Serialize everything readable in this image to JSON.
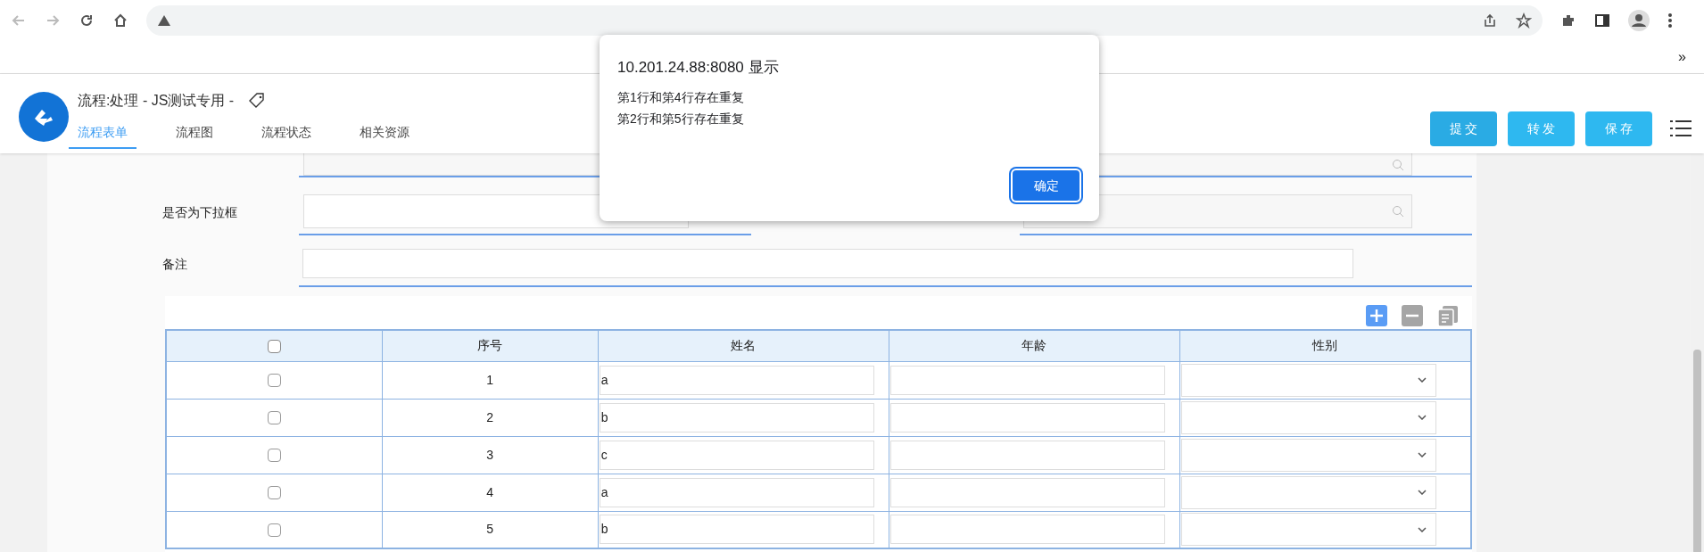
{
  "browser": {
    "bookmarks_overflow": "»"
  },
  "app": {
    "title": "流程:处理 - JS测试专用 -",
    "tabs": [
      {
        "label": "流程表单",
        "selected": true
      },
      {
        "label": "流程图",
        "selected": false
      },
      {
        "label": "流程状态",
        "selected": false
      },
      {
        "label": "相关资源",
        "selected": false
      }
    ],
    "buttons": [
      "提 交",
      "转 发",
      "保 存"
    ]
  },
  "form": {
    "fields": [
      {
        "label": "是否为下拉框"
      },
      {
        "label": "备注"
      }
    ]
  },
  "table": {
    "header_checked": false,
    "columns": [
      "序号",
      "姓名",
      "年龄",
      "性别"
    ],
    "rows": [
      {
        "checked": false,
        "no": "1",
        "name": "a"
      },
      {
        "checked": false,
        "no": "2",
        "name": "b"
      },
      {
        "checked": false,
        "no": "3",
        "name": "c"
      },
      {
        "checked": false,
        "no": "4",
        "name": "a"
      },
      {
        "checked": false,
        "no": "5",
        "name": "b"
      }
    ]
  },
  "dialog": {
    "title": "10.201.24.88:8080 显示",
    "messages": [
      "第1行和第4行存在重复",
      "第2行和第5行存在重复"
    ],
    "button": "确定"
  }
}
